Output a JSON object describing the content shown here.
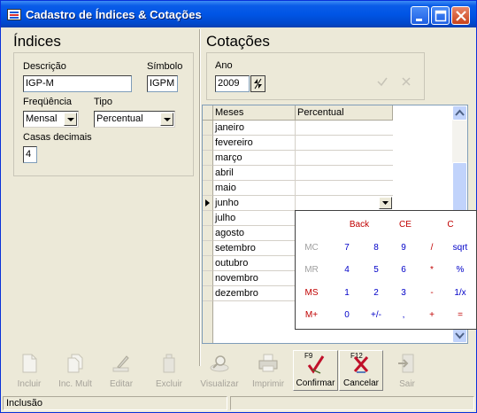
{
  "window": {
    "title": "Cadastro de Índices & Cotações"
  },
  "indices": {
    "heading": "Índices",
    "descricao_label": "Descrição",
    "descricao_value": "IGP-M",
    "simbolo_label": "Símbolo",
    "simbolo_value": "IGPM",
    "frequencia_label": "Freqüência",
    "frequencia_value": "Mensal",
    "tipo_label": "Tipo",
    "tipo_value": "Percentual",
    "casas_label": "Casas decimais",
    "casas_value": "4"
  },
  "cotacoes": {
    "heading": "Cotações",
    "ano_label": "Ano",
    "ano_value": "2009",
    "columns": [
      "Meses",
      "Percentual"
    ],
    "rows": [
      "janeiro",
      "fevereiro",
      "março",
      "abril",
      "maio",
      "junho",
      "julho",
      "agosto",
      "setembro",
      "outubro",
      "novembro",
      "dezembro"
    ],
    "current_row": "junho"
  },
  "calculator": {
    "row0": [
      "Back",
      "CE",
      "C"
    ],
    "row1": [
      "MC",
      "7",
      "8",
      "9",
      "/",
      "sqrt"
    ],
    "row2": [
      "MR",
      "4",
      "5",
      "6",
      "*",
      "%"
    ],
    "row3": [
      "MS",
      "1",
      "2",
      "3",
      "-",
      "1/x"
    ],
    "row4": [
      "M+",
      "0",
      "+/-",
      ",",
      "+",
      "="
    ]
  },
  "toolbar": {
    "incluir": "Incluir",
    "inc_mult": "Inc. Mult",
    "editar": "Editar",
    "excluir": "Excluir",
    "visualizar": "Visualizar",
    "imprimir": "Imprimir",
    "confirmar": "Confirmar",
    "confirmar_key": "F9",
    "cancelar": "Cancelar",
    "cancelar_key": "F12",
    "sair": "Sair"
  },
  "status": {
    "mode": "Inclusão"
  },
  "colors": {
    "titlebar": "#0055e5",
    "accent_red": "#c00000",
    "calc_blue": "#0000c8"
  }
}
